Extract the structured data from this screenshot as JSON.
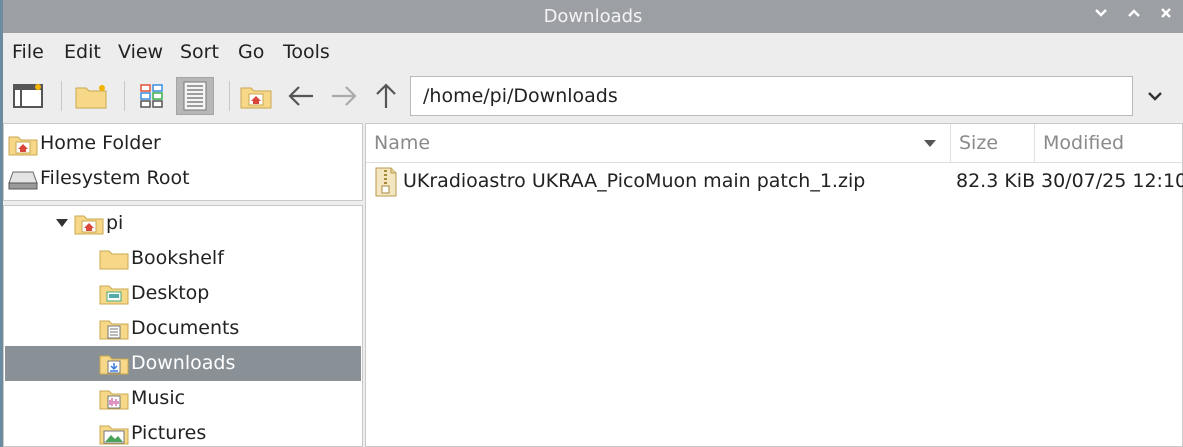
{
  "window": {
    "title": "Downloads"
  },
  "menu": [
    "File",
    "Edit",
    "View",
    "Sort",
    "Go",
    "Tools"
  ],
  "toolbar": {
    "path": "/home/pi/Downloads"
  },
  "places": [
    {
      "label": "Home Folder",
      "icon": "home-folder-icon"
    },
    {
      "label": "Filesystem Root",
      "icon": "drive-icon"
    }
  ],
  "tree": {
    "root": "pi",
    "children": [
      "Bookshelf",
      "Desktop",
      "Documents",
      "Downloads",
      "Music",
      "Pictures"
    ],
    "selected": "Downloads"
  },
  "columns": {
    "name": "Name",
    "size": "Size",
    "modified": "Modified"
  },
  "files": [
    {
      "name": "UKradioastro UKRAA_PicoMuon main patch_1.zip",
      "size": "82.3 KiB",
      "modified": "30/07/25 12:10",
      "icon": "zip-archive-icon"
    }
  ],
  "colors": {
    "titlebar": "#9c9fa3",
    "selection": "#8a9196",
    "folder": "#f7d889"
  }
}
